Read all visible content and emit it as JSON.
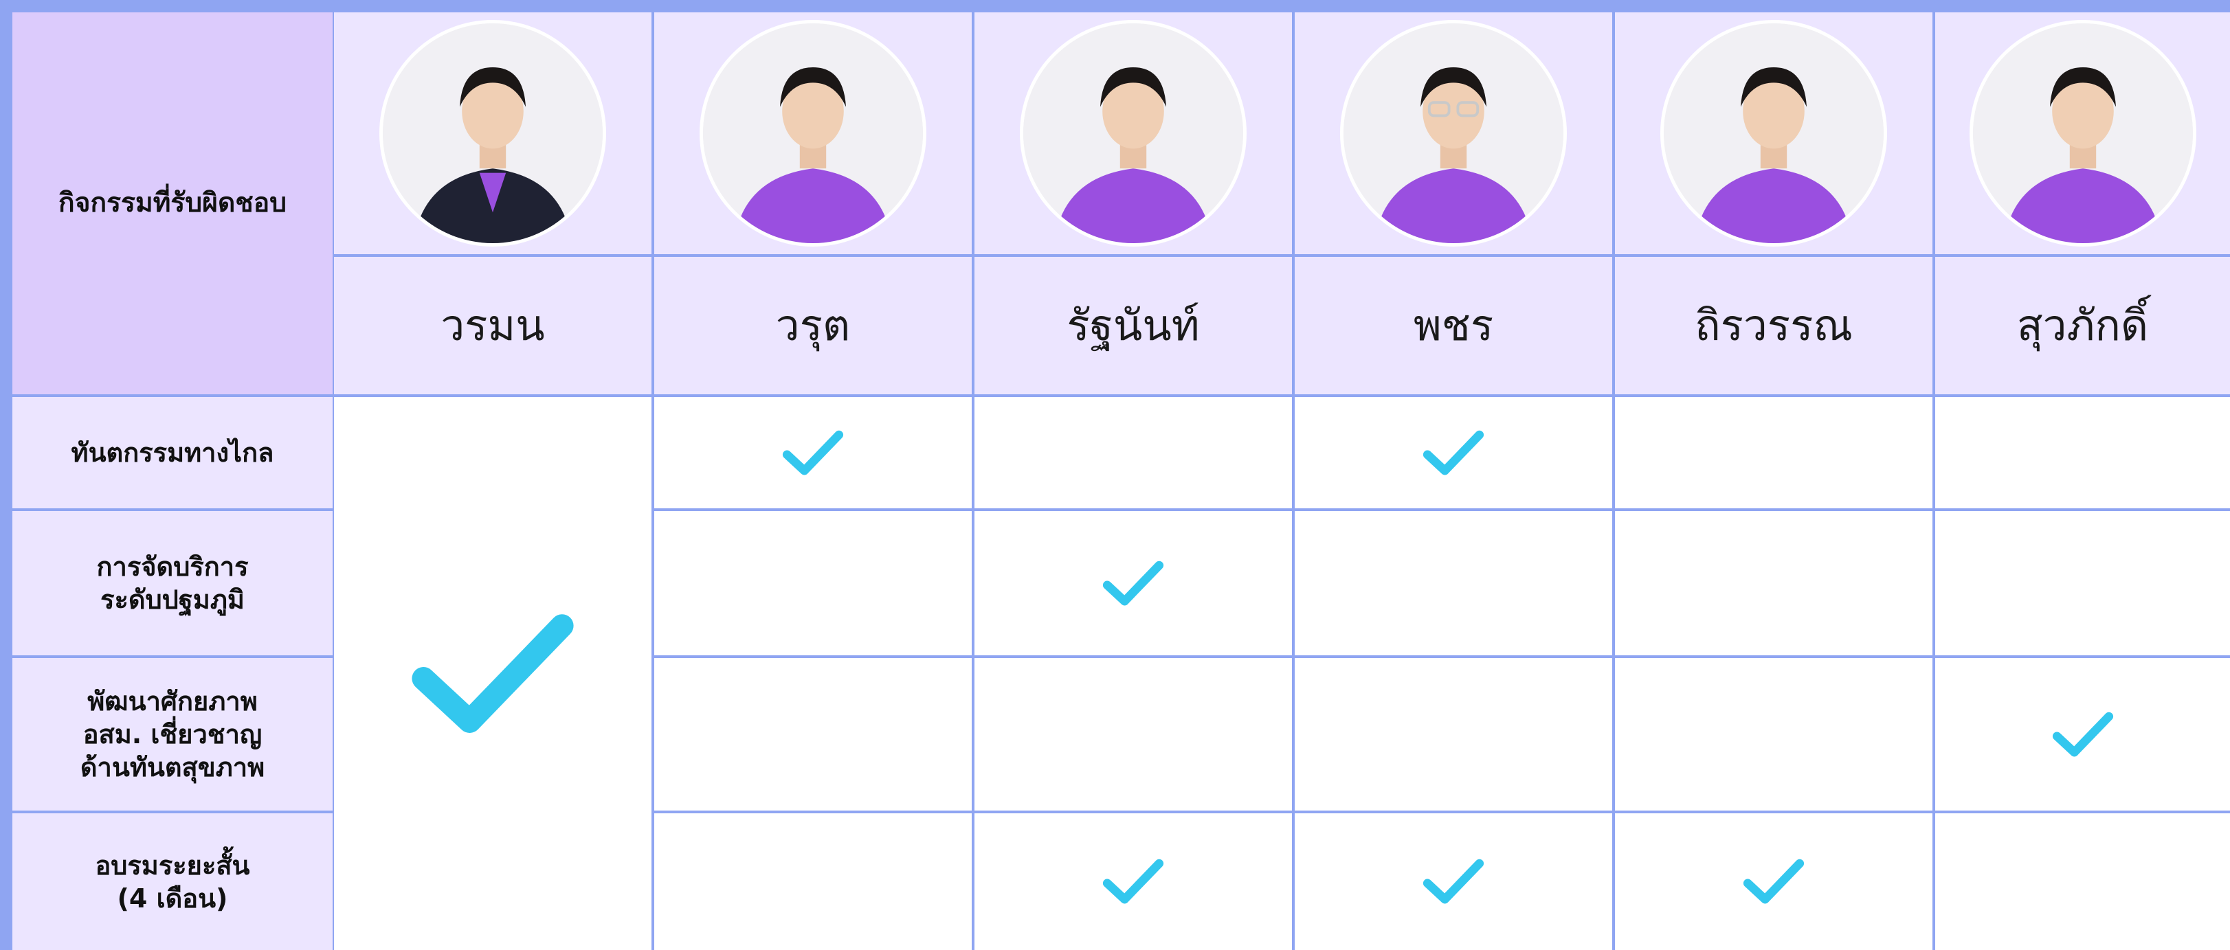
{
  "header": {
    "label": "กิจกรรมที่รับผิดชอบ"
  },
  "people": [
    {
      "name": "วรมน",
      "avatar": "avatar-suit"
    },
    {
      "name": "วรุต",
      "avatar": "avatar-purple-polo"
    },
    {
      "name": "รัฐนันท์",
      "avatar": "avatar-purple-polo"
    },
    {
      "name": "พชร",
      "avatar": "avatar-purple-polo-glasses"
    },
    {
      "name": "ถิรวรรณ",
      "avatar": "avatar-purple-polo"
    },
    {
      "name": "สุวภักดิ์",
      "avatar": "avatar-purple-polo"
    }
  ],
  "activities": [
    {
      "label": "ทันตกรรมทางไกล",
      "checks": [
        true,
        true,
        false,
        true,
        false,
        false
      ]
    },
    {
      "label": "การจัดบริการ\nระดับปฐมภูมิ",
      "checks": [
        true,
        false,
        true,
        false,
        false,
        false
      ]
    },
    {
      "label": "พัฒนาศักยภาพ\nอสม. เชี่ยวชาญ\nด้านทันตสุขภาพ",
      "checks": [
        true,
        false,
        false,
        false,
        false,
        true
      ]
    },
    {
      "label": "อบรมระยะสั้น\n(4 เดือน)",
      "checks": [
        true,
        false,
        true,
        true,
        true,
        false
      ]
    }
  ],
  "colors": {
    "grid": "#8fa5f2",
    "header_label_bg": "#dccbfc",
    "lavender_bg": "#ece5ff",
    "check": "#33c7ee",
    "polo": "#9a4fe0"
  }
}
